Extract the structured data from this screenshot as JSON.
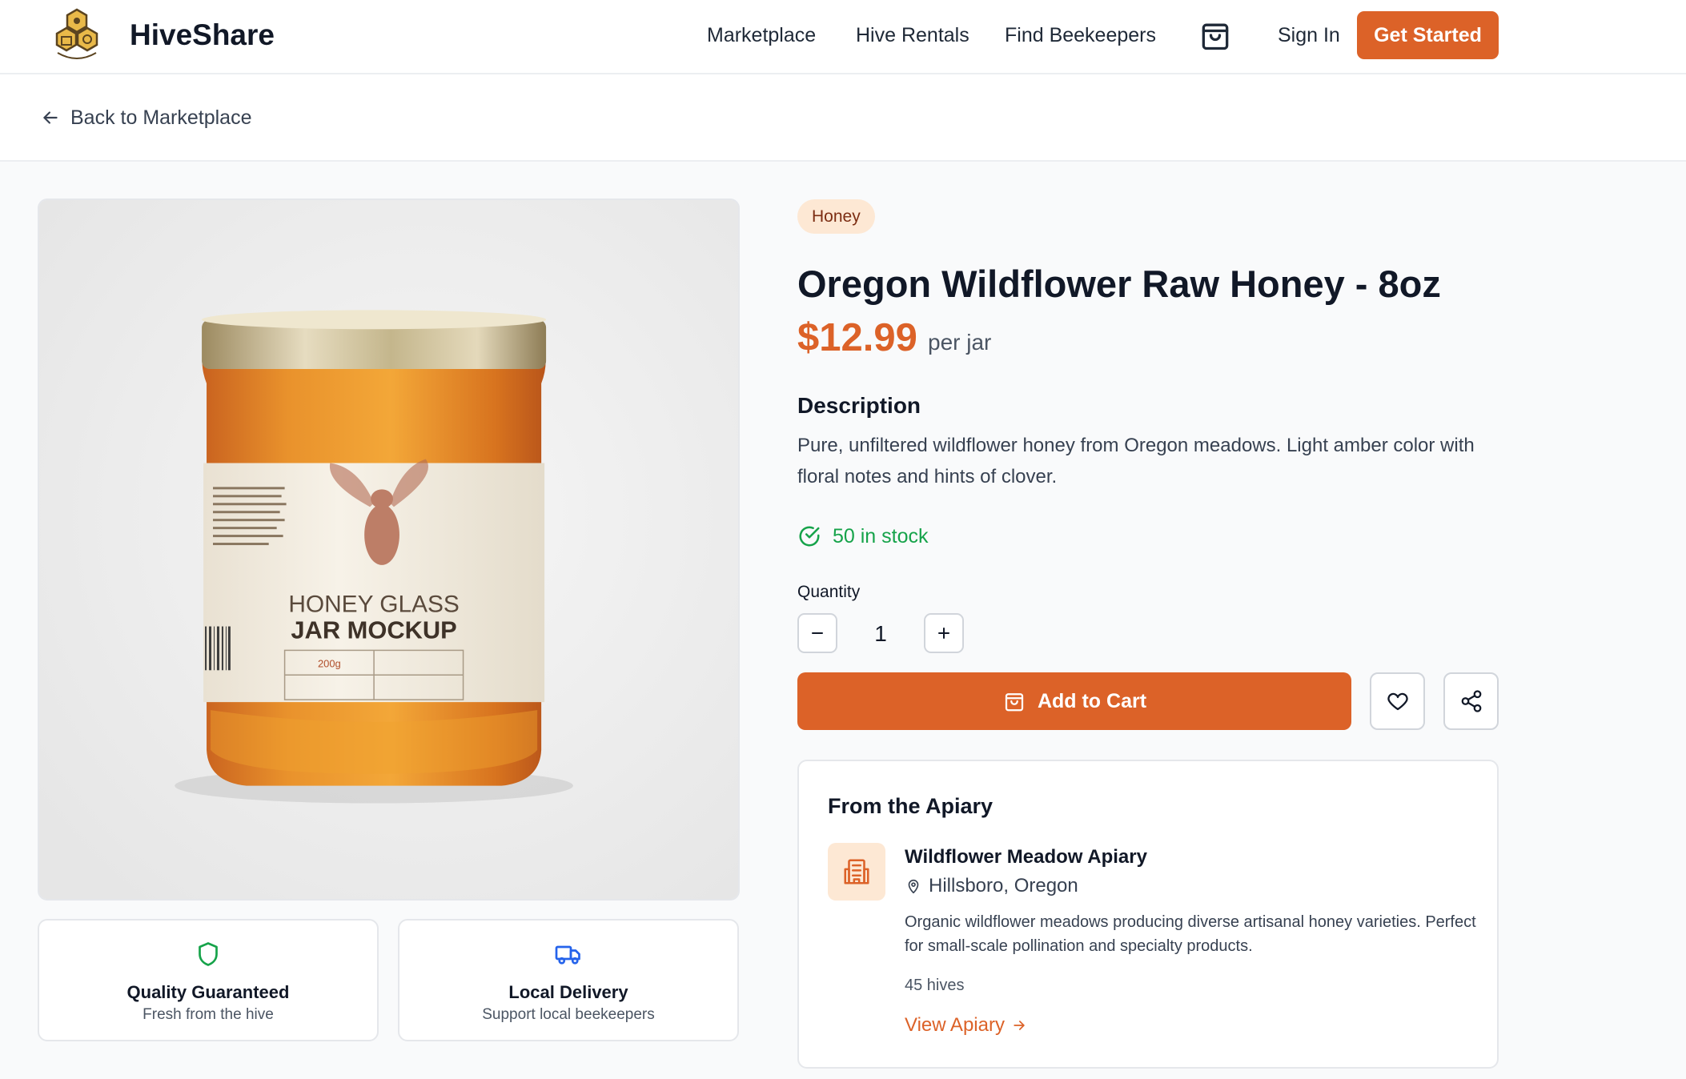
{
  "header": {
    "brand": "HiveShare",
    "nav": [
      "Marketplace",
      "Hive Rentals",
      "Find Beekeepers"
    ],
    "sign_in": "Sign In",
    "get_started": "Get Started"
  },
  "back_link": "Back to Marketplace",
  "product": {
    "category": "Honey",
    "title": "Oregon Wildflower Raw Honey - 8oz",
    "price": "$12.99",
    "price_unit": "per jar",
    "description_heading": "Description",
    "description": "Pure, unfiltered wildflower honey from Oregon meadows. Light amber color with floral notes and hints of clover.",
    "stock": "50 in stock",
    "quantity_label": "Quantity",
    "quantity": "1",
    "add_to_cart": "Add to Cart",
    "image_label_line1": "HONEY GLASS",
    "image_label_line2": "JAR MOCKUP",
    "image_weight": "200g"
  },
  "features": [
    {
      "title": "Quality Guaranteed",
      "subtitle": "Fresh from the hive",
      "icon": "shield-icon"
    },
    {
      "title": "Local Delivery",
      "subtitle": "Support local beekeepers",
      "icon": "truck-icon"
    }
  ],
  "apiary": {
    "heading": "From the Apiary",
    "name": "Wildflower Meadow Apiary",
    "location": "Hillsboro, Oregon",
    "description": "Organic wildflower meadows producing diverse artisanal honey varieties. Perfect for small-scale pollination and specialty products.",
    "hives": "45 hives",
    "link": "View Apiary"
  },
  "colors": {
    "accent": "#dc6228",
    "badge_bg": "#fde8d4",
    "stock_green": "#16a34a",
    "delivery_blue": "#2563eb"
  }
}
